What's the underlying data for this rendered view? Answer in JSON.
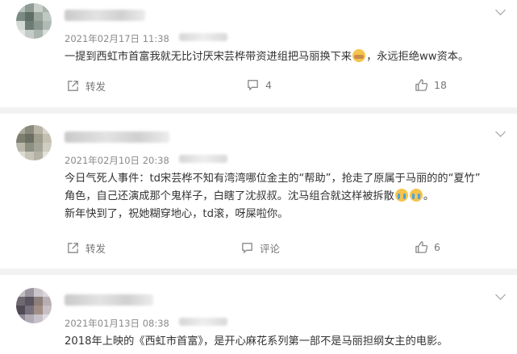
{
  "labels": {
    "repost": "转发",
    "comment": "评论"
  },
  "comments": [
    {
      "timestamp": "2021年02月17日 11:38",
      "lines": [
        "一提到西虹市首富我就无比讨厌宋芸桦带资进组把马丽换下来",
        "，永远拒绝ww资本。"
      ],
      "comment_count": "4",
      "like_count": "18"
    },
    {
      "timestamp": "2021年02月10日 20:38",
      "lines": [
        "今日气死人事件：td宋芸桦不知有湾湾哪位金主的“帮助”，抢走了原属于马丽的的“夏竹”",
        "角色，自己还演成那个鬼样子，白瞎了沈叔叔。沈马组合就这样被拆散",
        "。",
        "新年快到了，祝她糊穿地心，td滚，呀屎啦你。"
      ],
      "like_count": "6"
    },
    {
      "timestamp": "2021年01月13日 08:38",
      "lines": [
        "2018年上映的《西虹市首富》，是开心麻花系列第一部不是马丽担纲女主的电影。"
      ]
    }
  ],
  "icons": [
    "repost-icon",
    "comment-icon",
    "like-icon",
    "chevron-down-icon",
    "emoji-icon"
  ],
  "colors": {
    "separator": "#f2f2f2",
    "meta_text": "#8a8a8a",
    "action_text": "#777777"
  }
}
